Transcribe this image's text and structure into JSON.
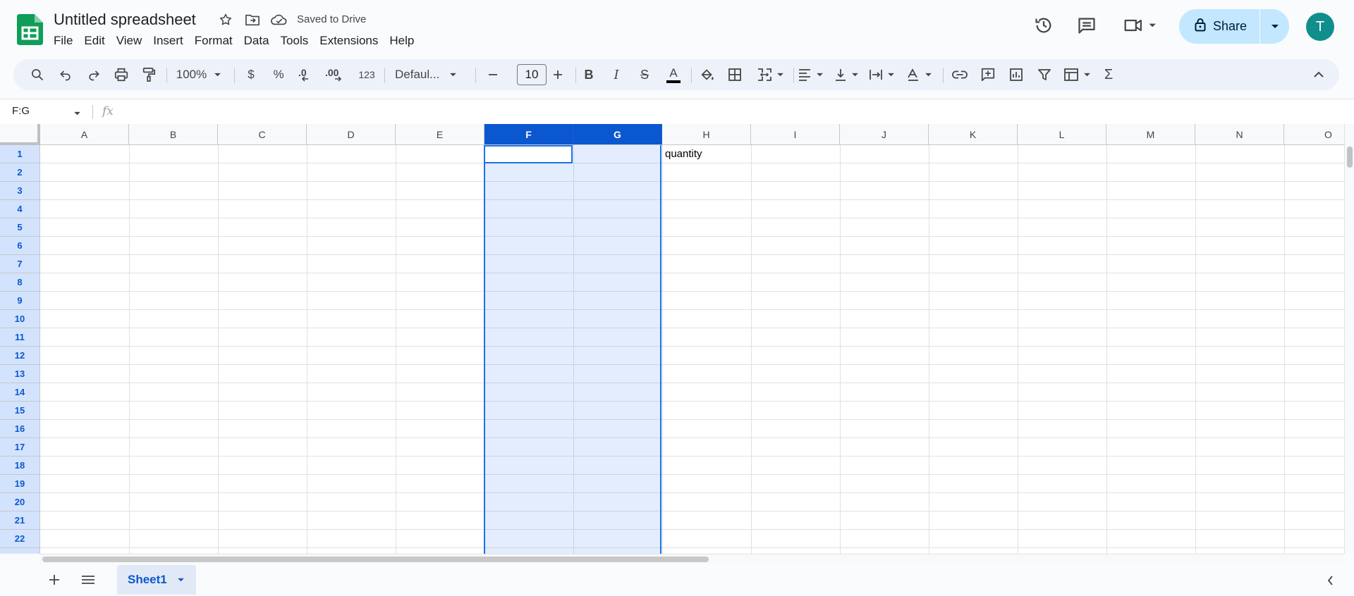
{
  "app": {
    "title": "Untitled spreadsheet",
    "save_status": "Saved to Drive",
    "brand_color": "#0f9d58"
  },
  "menu": [
    "File",
    "Edit",
    "View",
    "Insert",
    "Format",
    "Data",
    "Tools",
    "Extensions",
    "Help"
  ],
  "header": {
    "share_label": "Share",
    "avatar_initial": "T"
  },
  "toolbar": {
    "zoom": "100%",
    "currency": "$",
    "percent": "%",
    "decrease_decimal": ".0",
    "increase_decimal": ".00",
    "number_format": "123",
    "font_family": "Defaul...",
    "font_size": "10",
    "bold": "B",
    "italic": "I",
    "strikethrough": "S",
    "text_color_glyph": "A",
    "functions": "Σ"
  },
  "formula_bar": {
    "name_box": "F:G",
    "fx": "fx",
    "formula": ""
  },
  "grid": {
    "columns": [
      "A",
      "B",
      "C",
      "D",
      "E",
      "F",
      "G",
      "H",
      "I",
      "J",
      "K",
      "L",
      "M",
      "N",
      "O"
    ],
    "rows": [
      "1",
      "2",
      "3",
      "4",
      "5",
      "6",
      "7",
      "8",
      "9",
      "10",
      "11",
      "12",
      "13",
      "14",
      "15",
      "16",
      "17",
      "18",
      "19",
      "20",
      "21",
      "22"
    ],
    "selected_columns": [
      "F",
      "G"
    ],
    "active_cell": "F1",
    "cells": {
      "H1": "quantity"
    }
  },
  "sheets": {
    "tabs": [
      {
        "name": "Sheet1",
        "active": true
      }
    ]
  },
  "colors": {
    "selection": "#0b57d0",
    "share_bg": "#c2e7ff",
    "avatar": "#0f8e8c"
  }
}
